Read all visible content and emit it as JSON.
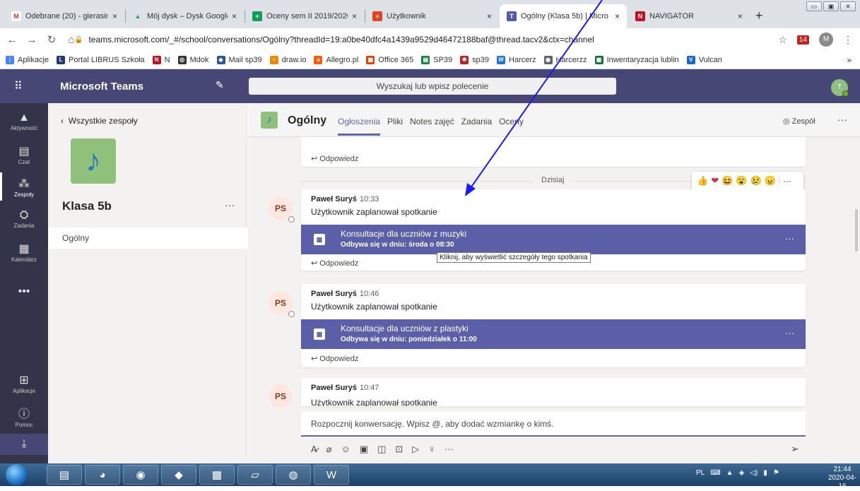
{
  "browser": {
    "tabs": [
      {
        "label": "Odebrane (20) - gierasim",
        "icon": "gmail-icon",
        "color": "#d93025",
        "glyph": "M"
      },
      {
        "label": "Mój dysk – Dysk Google",
        "icon": "drive-icon",
        "color": "#1fa463",
        "glyph": "▲"
      },
      {
        "label": "Oceny sem II 2019/2020",
        "icon": "sheets-icon",
        "color": "#0f9d58",
        "glyph": "+"
      },
      {
        "label": "Użytkownik",
        "icon": "office-icon",
        "color": "#e3431e",
        "glyph": "+"
      },
      {
        "label": "Ogólny (Klasa 5b) | Micro",
        "icon": "teams-icon",
        "color": "#5558af",
        "glyph": "T"
      },
      {
        "label": "NAVIGATOR",
        "icon": "navigator-icon",
        "color": "#c50f1f",
        "glyph": "N"
      }
    ],
    "close_glyph": "×",
    "new_tab": "+",
    "url": "teams.microsoft.com/_#/school/conversations/Ogólny?threadId=19:a0be40dfc4a1439a9529d46472188baf@thread.tacv2&ctx=channel",
    "profile_initial": "M",
    "extension_badge": "14",
    "bookmarks": [
      {
        "label": "Aplikacje",
        "color": "#4285f4"
      },
      {
        "label": "Portal LIBRUS Szkoła",
        "color": "#1f3b73"
      },
      {
        "label": "N",
        "color": "#c50f1f"
      },
      {
        "label": "Mdok",
        "color": "#333333"
      },
      {
        "label": "Mail sp39",
        "color": "#2b579a"
      },
      {
        "label": "draw.io",
        "color": "#f08705"
      },
      {
        "label": "Allegro.pl",
        "color": "#ff5a00"
      },
      {
        "label": "Office 365",
        "color": "#eb3c00"
      },
      {
        "label": "SP39",
        "color": "#188038"
      },
      {
        "label": "sp39",
        "color": "#c5221f"
      },
      {
        "label": "Harcerz",
        "color": "#1a73e8"
      },
      {
        "label": "Harcerzz",
        "color": "#5f6368"
      },
      {
        "label": "Inwentaryzacja lublin",
        "color": "#137333"
      },
      {
        "label": "Vulcan",
        "color": "#1967d2"
      }
    ]
  },
  "teams": {
    "app_title": "Microsoft Teams",
    "search_placeholder": "Wyszukaj lub wpisz polecenie",
    "user_initial": "T",
    "rail": [
      {
        "label": "Aktywność",
        "icon": "bell-icon",
        "glyph": "🔔"
      },
      {
        "label": "Czat",
        "icon": "chat-icon",
        "glyph": "▤"
      },
      {
        "label": "Zespoły",
        "icon": "teams-icon",
        "glyph": "⁂"
      },
      {
        "label": "Zadania",
        "icon": "assignments-icon",
        "glyph": "⛭"
      },
      {
        "label": "Kalendarz",
        "icon": "calendar-icon",
        "glyph": "▦"
      },
      {
        "label": "",
        "icon": "more-icon",
        "glyph": "•••"
      },
      {
        "label": "Aplikacje",
        "icon": "apps-icon",
        "glyph": "⊞"
      },
      {
        "label": "Pomoc",
        "icon": "help-icon",
        "glyph": "?"
      }
    ],
    "panel": {
      "back_label": "Wszystkie zespoły",
      "team_name": "Klasa 5b",
      "channel": "Ogólny"
    },
    "channel": {
      "name": "Ogólny",
      "tabs": [
        "Ogłoszenia",
        "Pliki",
        "Notes zajęć",
        "Zadania",
        "Oceny"
      ],
      "team_button": "Zespół"
    },
    "feed": {
      "reply_label": "Odpowiedz",
      "day_label": "Dzisiaj",
      "posts": [
        {
          "initials": "PS",
          "author": "Paweł Suryś",
          "time": "10:33",
          "text": "Użytkownik zaplanował spotkanie",
          "meeting_title": "Konsultacje dla uczniów z muzyki",
          "meeting_date": "Odbywa się w dniu: środa o 08:30"
        },
        {
          "initials": "PS",
          "author": "Paweł Suryś",
          "time": "10:46",
          "text": "Użytkownik zaplanował spotkanie",
          "meeting_title": "Konsultacje dla uczniów z plastyki",
          "meeting_date": "Odbywa się w dniu: poniedziałek o 11:00"
        },
        {
          "initials": "PS",
          "author": "Paweł Suryś",
          "time": "10:47",
          "text": "Użytkownik zaplanował spotkanie"
        }
      ],
      "tooltip": "Kliknij, aby wyświetlić szczegóły tego spotkania",
      "reactions": [
        "👍",
        "❤",
        "😆",
        "😮",
        "😢",
        "😠"
      ]
    },
    "compose_placeholder": "Rozpocznij konwersację. Wpisz @, aby dodać wzmiankę o kimś."
  },
  "taskbar": {
    "lang": "PL",
    "time": "21:44",
    "date": "2020-04-16"
  }
}
